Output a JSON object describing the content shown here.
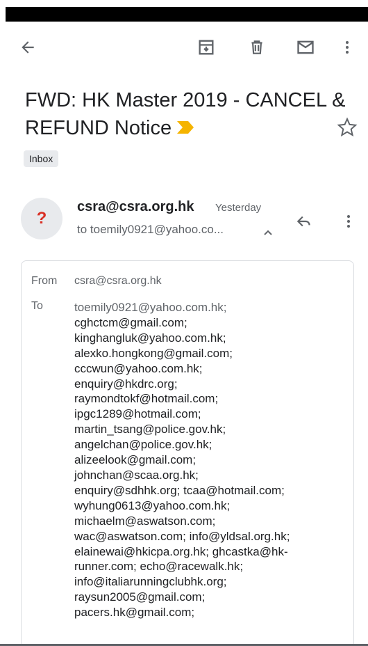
{
  "subject": {
    "title": "FWD: HK Master 2019 - CANCEL & REFUND Notice",
    "label": "Inbox"
  },
  "icons": {
    "back": "arrow-left-icon",
    "archive": "archive-icon",
    "delete": "trash-icon",
    "mail": "mail-icon",
    "more": "more-vert-icon",
    "important": "important-marker-icon",
    "star": "star-outline-icon",
    "reply": "reply-icon",
    "caret": "chevron-up-icon"
  },
  "colors": {
    "important_marker": "#f5b400",
    "avatar_question": "#d93025",
    "chip_bg": "#e8eaed"
  },
  "sender": {
    "avatar_glyph": "?",
    "email": "csra@csra.org.hk",
    "time": "Yesterday",
    "to_summary": "to toemily0921@yahoo.co..."
  },
  "details": {
    "from_label": "From",
    "from_value": "csra@csra.org.hk",
    "to_label": "To",
    "to_lines": [
      "toemily0921@yahoo.com.hk;",
      "cghctcm@gmail.com;",
      "kinghangluk@yahoo.com.hk;",
      " alexko.hongkong@gmail.com;",
      "cccwun@yahoo.com.hk;",
      "enquiry@hkdrc.org;",
      " raymondtokf@hotmail.com;",
      "ipgc1289@hotmail.com;",
      "martin_tsang@police.gov.hk;",
      " angelchan@police.gov.hk;",
      "alizeelook@gmail.com;",
      "johnchan@scaa.org.hk;",
      " enquiry@sdhhk.org; tcaa@hotmail.com;",
      "wyhung0613@yahoo.com.hk;",
      " michaelm@aswatson.com;",
      "wac@aswatson.com; info@yldsal.org.hk;",
      " elainewai@hkicpa.org.hk; ghcastka@hk-",
      "runner.com; echo@racewalk.hk;",
      " info@italiarunningclubhk.org;",
      "raysun2005@gmail.com;",
      "pacers.hk@gmail.com;"
    ]
  }
}
